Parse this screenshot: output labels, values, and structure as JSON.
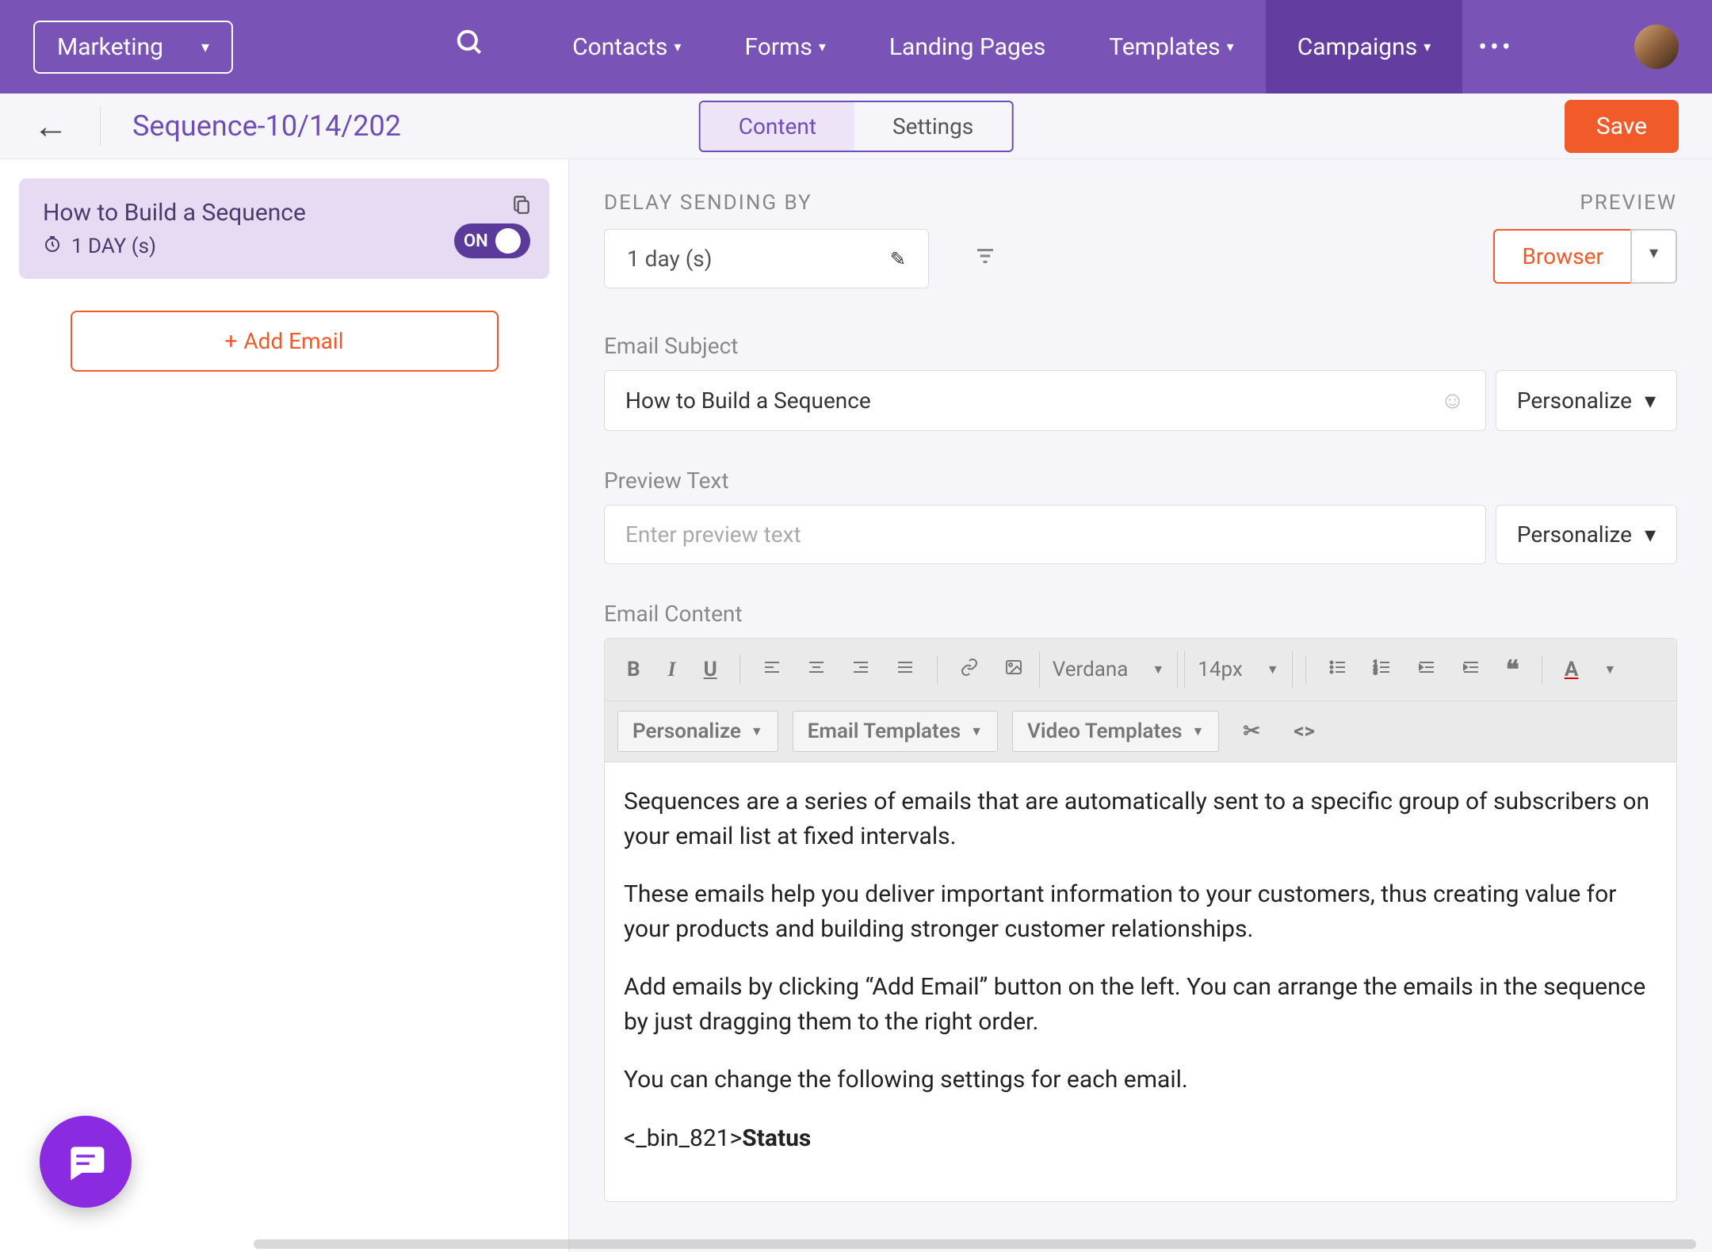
{
  "topnav": {
    "workspace": "Marketing",
    "items": [
      {
        "label": "Contacts",
        "dd": true
      },
      {
        "label": "Forms",
        "dd": true
      },
      {
        "label": "Landing Pages",
        "dd": false
      },
      {
        "label": "Templates",
        "dd": true
      },
      {
        "label": "Campaigns",
        "dd": true,
        "active": true
      }
    ]
  },
  "subhead": {
    "title": "Sequence-10/14/202",
    "tabs": [
      {
        "label": "Content",
        "active": true
      },
      {
        "label": "Settings",
        "active": false
      }
    ],
    "save": "Save"
  },
  "sidebar": {
    "card": {
      "title": "How to Build a Sequence",
      "delay": "1 DAY (s)",
      "toggle": "ON"
    },
    "add_email": "Add Email"
  },
  "main": {
    "delay_label": "DELAY SENDING BY",
    "delay_value": "1 day (s)",
    "preview_label": "PREVIEW",
    "preview_button": "Browser",
    "subject_label": "Email Subject",
    "subject_value": "How to Build a Sequence",
    "preview_text_label": "Preview Text",
    "preview_text_placeholder": "Enter preview text",
    "personalize": "Personalize",
    "content_label": "Email Content",
    "toolbar": {
      "font": "Verdana",
      "size": "14px",
      "personalize": "Personalize",
      "email_templates": "Email Templates",
      "video_templates": "Video Templates"
    },
    "body": {
      "p1": "Sequences are a series of emails that are automatically sent to a specific group of subscribers on your email list at fixed intervals.",
      "p2": "These emails help you deliver important information to your customers, thus creating value for your products and building stronger customer relationships.",
      "p3": "Add emails by clicking “Add Email” button on the left. You can arrange the emails in the sequence by just dragging them to the right order.",
      "p4": "You can change the following settings for each email.",
      "h1": "Status"
    }
  }
}
